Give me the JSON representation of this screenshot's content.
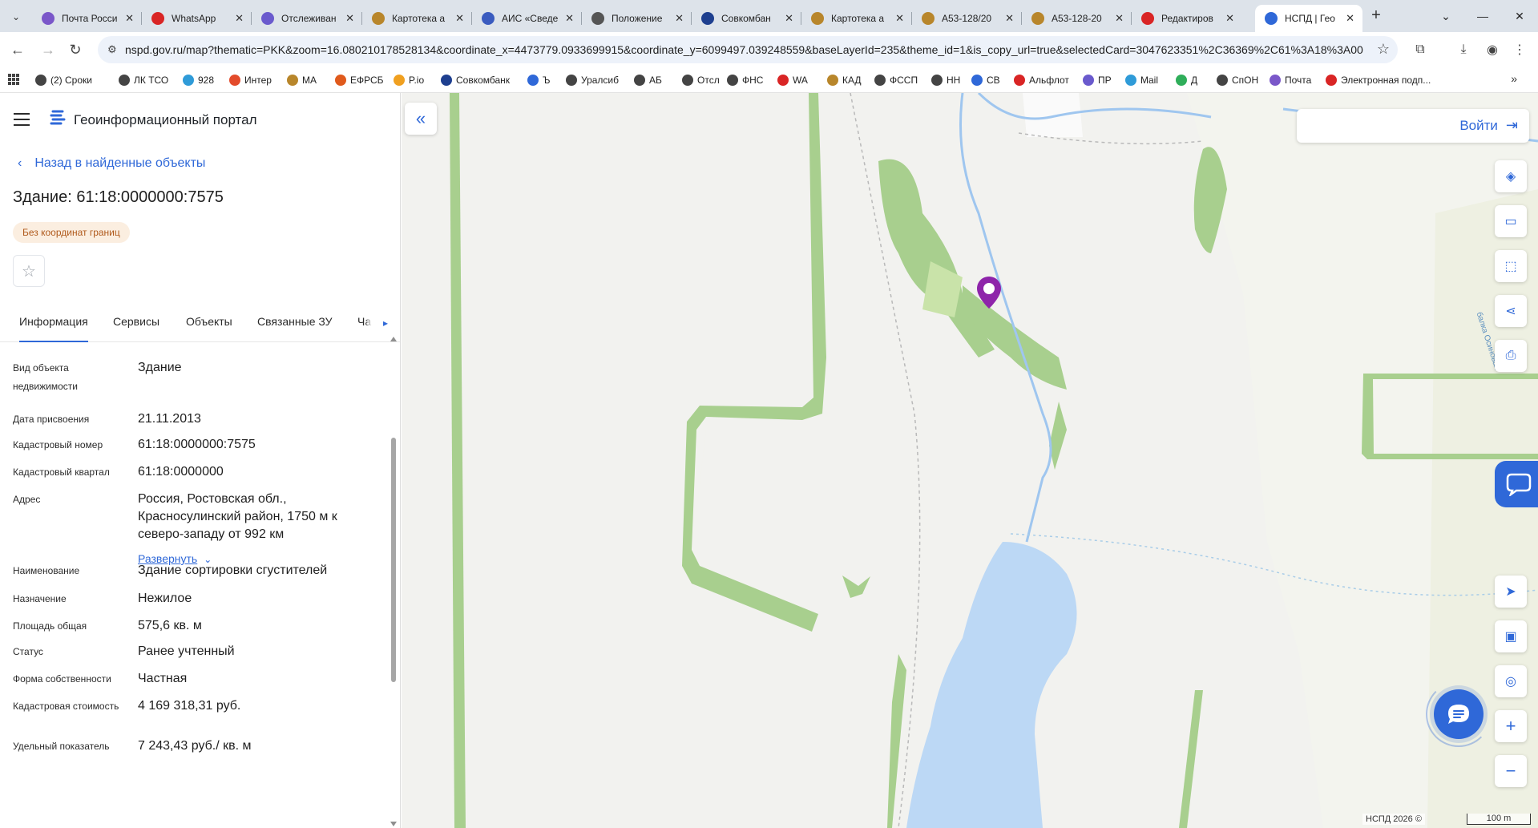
{
  "browser": {
    "tabs": [
      {
        "title": "Почта Росси",
        "color": "#7a57c9"
      },
      {
        "title": "WhatsApp",
        "color": "#d92525"
      },
      {
        "title": "Отслеживан",
        "color": "#6a5acd"
      },
      {
        "title": "Картотека а",
        "color": "#b8862b"
      },
      {
        "title": "АИС «Сведе",
        "color": "#3a5bbf"
      },
      {
        "title": "Положение",
        "color": "#555555"
      },
      {
        "title": "Совкомбан",
        "color": "#1e3f8f"
      },
      {
        "title": "Картотека а",
        "color": "#b8862b"
      },
      {
        "title": "А53-128/20",
        "color": "#b8862b"
      },
      {
        "title": "А53-128-20",
        "color": "#b8862b"
      },
      {
        "title": "Редактиров",
        "color": "#d92525"
      },
      {
        "title": "НСПД | Гео",
        "color": "#2f68d8"
      }
    ],
    "close_glyph": "✕",
    "new_tab": "+",
    "url": "nspd.gov.ru/map?thematic=PKK&zoom=16.080210178528134&coordinate_x=4473779.0933699915&coordinate_y=6099497.039248559&baseLayerId=235&theme_id=1&is_copy_url=true&selectedCard=3047623351%2C36369%2C61%3A18%3A000...",
    "bookmarks": [
      {
        "label": "(2) Сроки",
        "color": "#444444"
      },
      {
        "label": "ЛК ТСО",
        "color": "#444444"
      },
      {
        "label": "928",
        "color": "#2f9bd8"
      },
      {
        "label": "Интер",
        "color": "#e34b2b"
      },
      {
        "label": "МА",
        "color": "#b8862b"
      },
      {
        "label": "ЕФРСБ",
        "color": "#e05a1c"
      },
      {
        "label": "P.io",
        "color": "#f0a020"
      },
      {
        "label": "Совкомбанк",
        "color": "#1e3f8f"
      },
      {
        "label": "Ъ",
        "color": "#2f68d8"
      },
      {
        "label": "Уралсиб",
        "color": "#444444"
      },
      {
        "label": "АБ",
        "color": "#444444"
      },
      {
        "label": "Отсл",
        "color": "#444444"
      },
      {
        "label": "ФНС",
        "color": "#444444"
      },
      {
        "label": "WA",
        "color": "#d92525"
      },
      {
        "label": "КАД",
        "color": "#b8862b"
      },
      {
        "label": "ФССП",
        "color": "#444444"
      },
      {
        "label": "НН",
        "color": "#444444"
      },
      {
        "label": "СВ",
        "color": "#2f68d8"
      },
      {
        "label": "Альфлот",
        "color": "#d92525"
      },
      {
        "label": "ПР",
        "color": "#6a5acd"
      },
      {
        "label": "Mail",
        "color": "#2f9bd8"
      },
      {
        "label": "Д",
        "color": "#2fae5a"
      },
      {
        "label": "СпОН",
        "color": "#444444"
      },
      {
        "label": "Почта",
        "color": "#7a57c9"
      },
      {
        "label": "Электронная подп...",
        "color": "#d92525"
      }
    ],
    "bookmarks_more": "»"
  },
  "panel": {
    "portal_title": "Геоинформационный портал",
    "back_label": "Назад в найденные объекты",
    "object_title": "Здание: 61:18:0000000:7575",
    "badge": "Без координат границ",
    "favorite_glyph": "☆",
    "tabs": [
      "Информация",
      "Сервисы",
      "Объекты",
      "Связанные ЗУ",
      "Ча"
    ],
    "active_tab": 0,
    "fields": [
      {
        "label": "Вид объекта недвижимости",
        "value": "Здание"
      },
      {
        "label": "Дата присвоения",
        "value": "21.11.2013"
      },
      {
        "label": "Кадастровый номер",
        "value": "61:18:0000000:7575"
      },
      {
        "label": "Кадастровый квартал",
        "value": "61:18:0000000"
      },
      {
        "label": "Адрес",
        "value": "Россия, Ростовская обл., Красносулинский район, 1750 м к северо-западу от 992 км"
      },
      {
        "label": "Наименование",
        "value": "Здание сортировки сгустителей"
      },
      {
        "label": "Назначение",
        "value": "Нежилое"
      },
      {
        "label": "Площадь общая",
        "value": "575,6 кв. м"
      },
      {
        "label": "Статус",
        "value": "Ранее учтенный"
      },
      {
        "label": "Форма собственности",
        "value": "Частная"
      },
      {
        "label": "Кадастровая стоимость",
        "value": "4 169 318,31 руб."
      },
      {
        "label": "Удельный показатель",
        "value": "7 243,43 руб./ кв. м"
      }
    ],
    "expand_label": "Развернуть"
  },
  "map": {
    "login_label": "Войти",
    "river_label": "балка Осиновая",
    "attribution": "НСПД 2026 ©",
    "scale": "100 m",
    "colors": {
      "land": "#f2f2ef",
      "field": "#eef0e4",
      "forest": "#a8cf8e",
      "water": "#bcd8f5",
      "accent": "#2f68d8",
      "pin": "#8e24aa"
    }
  }
}
